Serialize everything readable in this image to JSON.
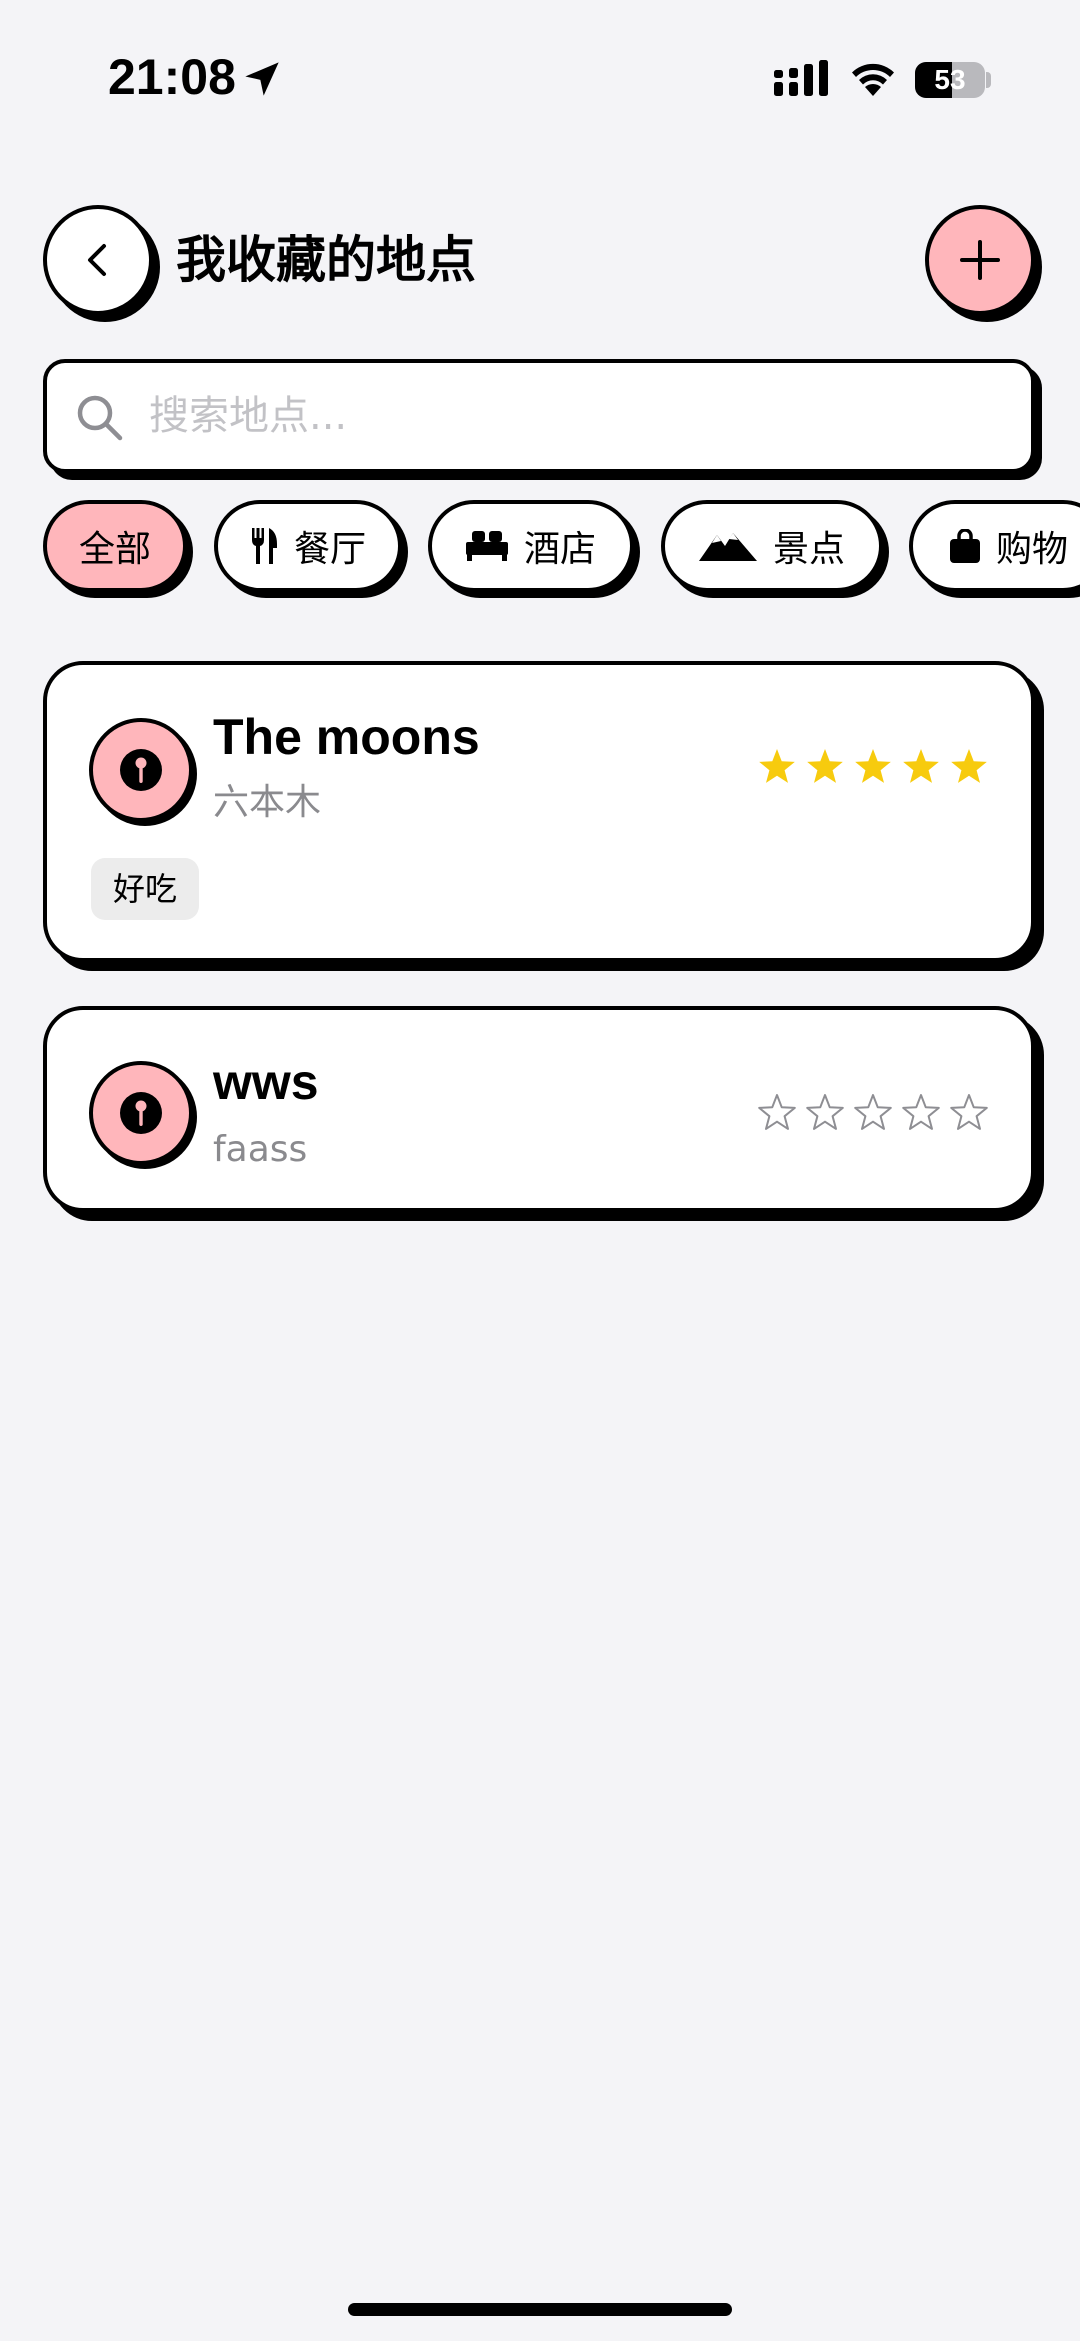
{
  "status_bar": {
    "time": "21:08",
    "battery_level": 53,
    "battery_text": "53",
    "icons": [
      "location-arrow-icon",
      "signal-icon",
      "wifi-icon",
      "battery-icon"
    ]
  },
  "header": {
    "title": "我收藏的地点",
    "back_icon": "chevron-left-icon",
    "add_icon": "plus-icon"
  },
  "search": {
    "placeholder": "搜索地点...",
    "value": "",
    "icon": "search-icon"
  },
  "filters": [
    {
      "label": "全部",
      "icon": "",
      "active": true
    },
    {
      "label": "餐厅",
      "icon": "fork-knife-icon",
      "active": false
    },
    {
      "label": "酒店",
      "icon": "bed-icon",
      "active": false
    },
    {
      "label": "景点",
      "icon": "mountain-icon",
      "active": false
    },
    {
      "label": "购物",
      "icon": "shopping-bag-icon",
      "active": false
    }
  ],
  "places": [
    {
      "name": "The moons",
      "subtitle": "六本木",
      "rating": 5,
      "max_rating": 5,
      "tags": [
        "好吃"
      ],
      "icon": "map-pin-icon"
    },
    {
      "name": "wws",
      "subtitle": "faass",
      "rating": 0,
      "max_rating": 5,
      "tags": [],
      "icon": "map-pin-icon"
    }
  ],
  "colors": {
    "accent_pink": "#ffb6bb",
    "star_filled": "#f7cb0e",
    "star_empty": "#8e8e93",
    "background": "#f4f4f7"
  }
}
